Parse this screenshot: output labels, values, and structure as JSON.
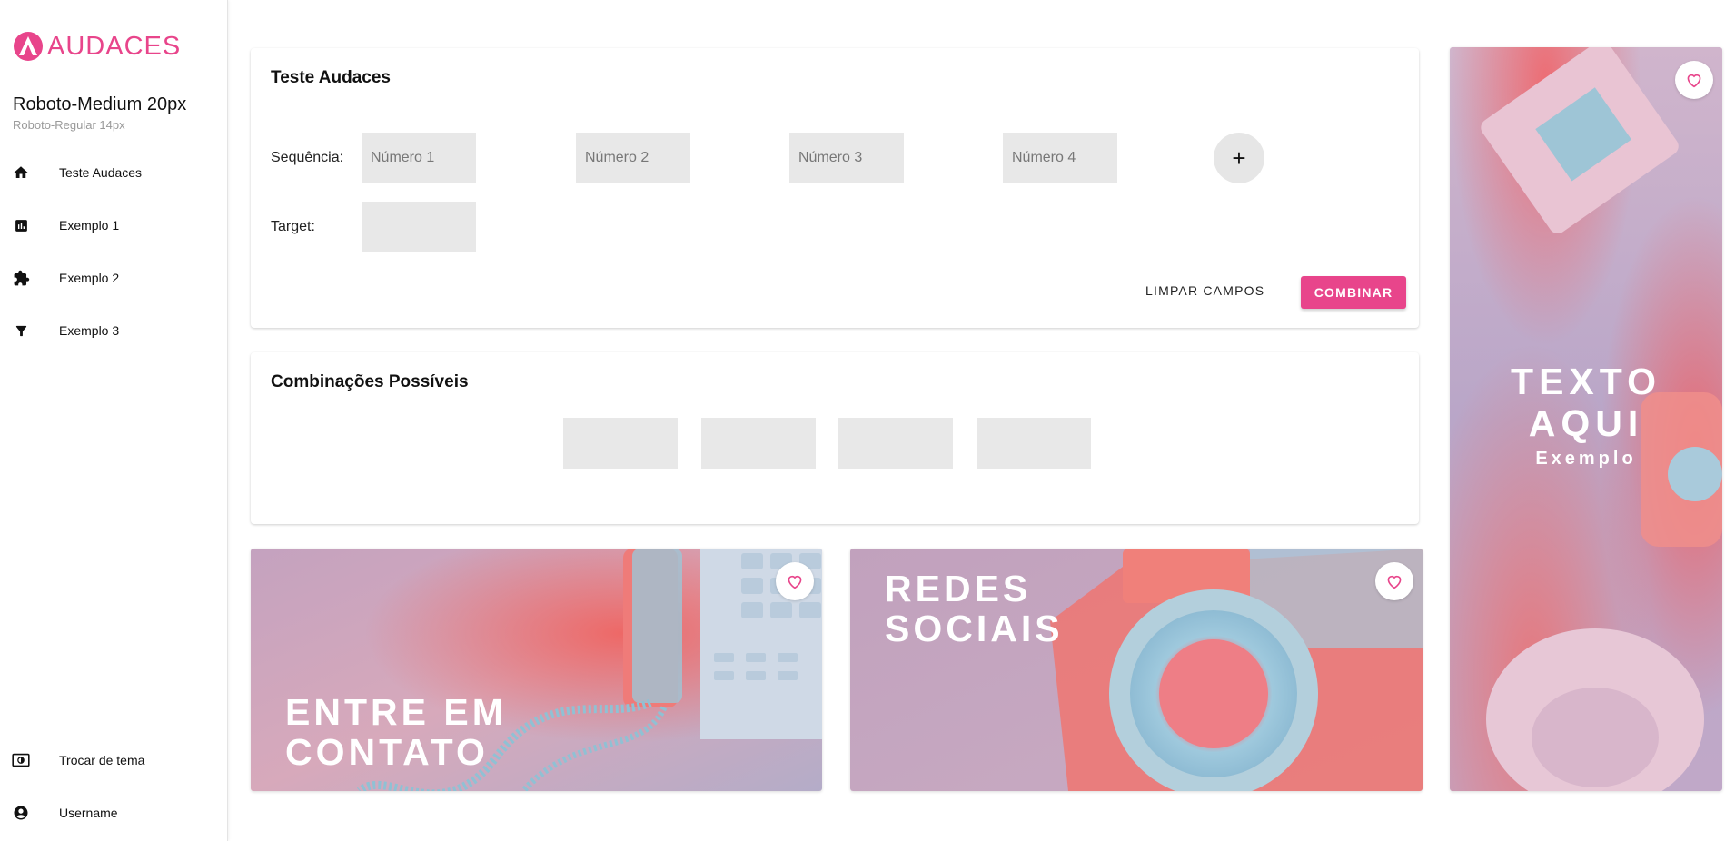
{
  "brand": {
    "name": "AUDACES",
    "accent": "#e8458b"
  },
  "profile": {
    "title": "Roboto-Medium 20px",
    "subtitle": "Roboto-Regular 14px"
  },
  "sidebar": {
    "items": [
      {
        "label": "Teste Audaces",
        "icon": "home-icon"
      },
      {
        "label": "Exemplo 1",
        "icon": "bar-chart-icon"
      },
      {
        "label": "Exemplo 2",
        "icon": "puzzle-icon"
      },
      {
        "label": "Exemplo 3",
        "icon": "filter-icon"
      }
    ],
    "bottom": [
      {
        "label": "Trocar de tema",
        "icon": "theme-toggle-icon"
      },
      {
        "label": "Username",
        "icon": "account-icon"
      }
    ]
  },
  "form_card": {
    "title": "Teste Audaces",
    "sequence_label": "Sequência:",
    "inputs": [
      {
        "placeholder": "Número 1",
        "value": ""
      },
      {
        "placeholder": "Número 2",
        "value": ""
      },
      {
        "placeholder": "Número 3",
        "value": ""
      },
      {
        "placeholder": "Número 4",
        "value": ""
      }
    ],
    "add_label": "+",
    "target_label": "Target:",
    "target_value": "",
    "clear_label": "LIMPAR CAMPOS",
    "combine_label": "COMBINAR"
  },
  "combos_card": {
    "title": "Combinações Possíveis",
    "boxes": [
      "",
      "",
      "",
      ""
    ]
  },
  "tiles": {
    "contact": "ENTRE EM CONTATO",
    "social": "REDES SOCIAIS",
    "vertical_title": "TEXTO AQUI",
    "vertical_subtitle": "Exemplo"
  }
}
